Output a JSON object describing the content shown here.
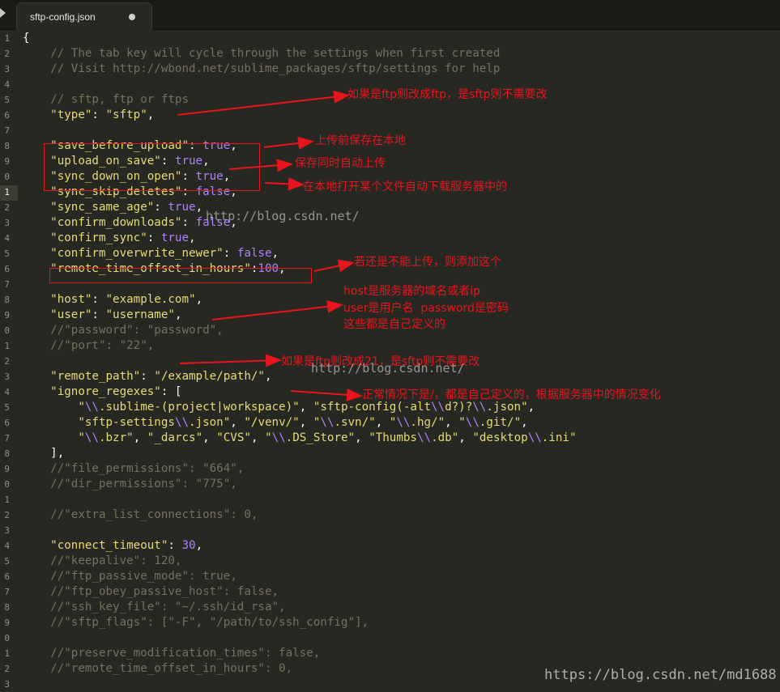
{
  "tab": {
    "title": "sftp-config.json"
  },
  "gutter": [
    "1",
    "2",
    "3",
    "4",
    "5",
    "6",
    "7",
    "8",
    "9",
    "0",
    "1",
    "2",
    "3",
    "4",
    "5",
    "6",
    "7",
    "8",
    "9",
    "0",
    "1",
    "2",
    "3",
    "4",
    "5",
    "6",
    "7",
    "8",
    "9",
    "0",
    "1",
    "2",
    "3",
    "4",
    "5",
    "6",
    "7",
    "8",
    "9",
    "0",
    "1",
    "2",
    "3"
  ],
  "code": [
    [
      [
        "p",
        "{"
      ]
    ],
    [
      [
        "c",
        "    // The tab key will cycle through the settings when first created"
      ]
    ],
    [
      [
        "c",
        "    // Visit http://wbond.net/sublime_packages/sftp/settings for help"
      ]
    ],
    [],
    [
      [
        "c",
        "    // sftp, ftp or ftps"
      ]
    ],
    [
      [
        "k",
        "    \"type\""
      ],
      [
        "p",
        ": "
      ],
      [
        "str",
        "\"sftp\""
      ],
      [
        "p",
        ","
      ]
    ],
    [],
    [
      [
        "k",
        "    \"save_before_upload\""
      ],
      [
        "p",
        ": "
      ],
      [
        "b",
        "true"
      ],
      [
        "p",
        ","
      ]
    ],
    [
      [
        "k",
        "    \"upload_on_save\""
      ],
      [
        "p",
        ": "
      ],
      [
        "b",
        "true"
      ],
      [
        "p",
        ","
      ]
    ],
    [
      [
        "k",
        "    \"sync_down_on_open\""
      ],
      [
        "p",
        ": "
      ],
      [
        "b",
        "true"
      ],
      [
        "p",
        ","
      ]
    ],
    [
      [
        "k",
        "    \"sync_skip_deletes\""
      ],
      [
        "p",
        ": "
      ],
      [
        "b",
        "false"
      ],
      [
        "p",
        ","
      ]
    ],
    [
      [
        "k",
        "    \"sync_same_age\""
      ],
      [
        "p",
        ": "
      ],
      [
        "b",
        "true"
      ],
      [
        "p",
        ","
      ]
    ],
    [
      [
        "k",
        "    \"confirm_downloads\""
      ],
      [
        "p",
        ": "
      ],
      [
        "b",
        "false"
      ],
      [
        "p",
        ","
      ]
    ],
    [
      [
        "k",
        "    \"confirm_sync\""
      ],
      [
        "p",
        ": "
      ],
      [
        "b",
        "true"
      ],
      [
        "p",
        ","
      ]
    ],
    [
      [
        "k",
        "    \"confirm_overwrite_newer\""
      ],
      [
        "p",
        ": "
      ],
      [
        "b",
        "false"
      ],
      [
        "p",
        ","
      ]
    ],
    [
      [
        "k",
        "    \"remote_time_offset_in_hours\""
      ],
      [
        "p",
        ":"
      ],
      [
        "n",
        "100"
      ],
      [
        "p",
        ","
      ]
    ],
    [],
    [
      [
        "k",
        "    \"host\""
      ],
      [
        "p",
        ": "
      ],
      [
        "str",
        "\"example.com\""
      ],
      [
        "p",
        ","
      ]
    ],
    [
      [
        "k",
        "    \"user\""
      ],
      [
        "p",
        ": "
      ],
      [
        "str",
        "\"username\""
      ],
      [
        "p",
        ","
      ]
    ],
    [
      [
        "c",
        "    //\"password\": \"password\","
      ]
    ],
    [
      [
        "c",
        "    //\"port\": \"22\","
      ]
    ],
    [],
    [
      [
        "k",
        "    \"remote_path\""
      ],
      [
        "p",
        ": "
      ],
      [
        "str",
        "\"/example/path/\""
      ],
      [
        "p",
        ","
      ]
    ],
    [
      [
        "k",
        "    \"ignore_regexes\""
      ],
      [
        "p",
        ": ["
      ]
    ],
    [
      [
        "str",
        "        \""
      ],
      [
        "esc",
        "\\\\"
      ],
      [
        "str",
        ".sublime-(project|workspace)\""
      ],
      [
        "p",
        ", "
      ],
      [
        "str",
        "\"sftp-config(-alt"
      ],
      [
        "esc",
        "\\\\"
      ],
      [
        "str",
        "d?)?"
      ],
      [
        "esc",
        "\\\\"
      ],
      [
        "str",
        ".json\""
      ],
      [
        "p",
        ","
      ]
    ],
    [
      [
        "str",
        "        \"sftp-settings"
      ],
      [
        "esc",
        "\\\\"
      ],
      [
        "str",
        ".json\""
      ],
      [
        "p",
        ", "
      ],
      [
        "str",
        "\"/venv/\""
      ],
      [
        "p",
        ", "
      ],
      [
        "str",
        "\""
      ],
      [
        "esc",
        "\\\\"
      ],
      [
        "str",
        ".svn/\""
      ],
      [
        "p",
        ", "
      ],
      [
        "str",
        "\""
      ],
      [
        "esc",
        "\\\\"
      ],
      [
        "str",
        ".hg/\""
      ],
      [
        "p",
        ", "
      ],
      [
        "str",
        "\""
      ],
      [
        "esc",
        "\\\\"
      ],
      [
        "str",
        ".git/\""
      ],
      [
        "p",
        ","
      ]
    ],
    [
      [
        "str",
        "        \""
      ],
      [
        "esc",
        "\\\\"
      ],
      [
        "str",
        ".bzr\""
      ],
      [
        "p",
        ", "
      ],
      [
        "str",
        "\"_darcs\""
      ],
      [
        "p",
        ", "
      ],
      [
        "str",
        "\"CVS\""
      ],
      [
        "p",
        ", "
      ],
      [
        "str",
        "\""
      ],
      [
        "esc",
        "\\\\"
      ],
      [
        "str",
        ".DS_Store\""
      ],
      [
        "p",
        ", "
      ],
      [
        "str",
        "\"Thumbs"
      ],
      [
        "esc",
        "\\\\"
      ],
      [
        "str",
        ".db\""
      ],
      [
        "p",
        ", "
      ],
      [
        "str",
        "\"desktop"
      ],
      [
        "esc",
        "\\\\"
      ],
      [
        "str",
        ".ini\""
      ]
    ],
    [
      [
        "p",
        "    ],"
      ]
    ],
    [
      [
        "c",
        "    //\"file_permissions\": \"664\","
      ]
    ],
    [
      [
        "c",
        "    //\"dir_permissions\": \"775\","
      ]
    ],
    [],
    [
      [
        "c",
        "    //\"extra_list_connections\": 0,"
      ]
    ],
    [],
    [
      [
        "k",
        "    \"connect_timeout\""
      ],
      [
        "p",
        ": "
      ],
      [
        "n",
        "30"
      ],
      [
        "p",
        ","
      ]
    ],
    [
      [
        "c",
        "    //\"keepalive\": 120,"
      ]
    ],
    [
      [
        "c",
        "    //\"ftp_passive_mode\": true,"
      ]
    ],
    [
      [
        "c",
        "    //\"ftp_obey_passive_host\": false,"
      ]
    ],
    [
      [
        "c",
        "    //\"ssh_key_file\": \"~/.ssh/id_rsa\","
      ]
    ],
    [
      [
        "c",
        "    //\"sftp_flags\": [\"-F\", \"/path/to/ssh_config\"],"
      ]
    ],
    [],
    [
      [
        "c",
        "    //\"preserve_modification_times\": false,"
      ]
    ],
    [
      [
        "c",
        "    //\"remote_time_offset_in_hours\": 0,"
      ]
    ]
  ],
  "annotations": {
    "type_note": "如果是ftp则改成ftp，是sftp则不需要改",
    "save_note": "上传前保存在本地",
    "upload_note": "保存同时自动上传",
    "sync_note": "在本地打开某个文件自动下载服务器中的",
    "offset_note": "若还是不能上传，则添加这个",
    "host_note_1": "host是服务器的域名或者ip",
    "host_note_2": "user是用户名  password是密码",
    "host_note_3": "这些都是自己定义的",
    "port_note": "如果是ftp则改成21，是sftp则不需要改",
    "path_note": "正常情况下是/，都是自己定义的，根据服务器中的情况变化"
  },
  "watermarks": {
    "wm1": "http://blog.csdn.net/",
    "wm2": "http://blog.csdn.net/",
    "wm3": "https://blog.csdn.net/md1688"
  },
  "colors": {
    "background": "#272822",
    "annotation": "#e8141e",
    "string": "#e6db74",
    "constant": "#ae81ff",
    "comment": "#75715e"
  }
}
